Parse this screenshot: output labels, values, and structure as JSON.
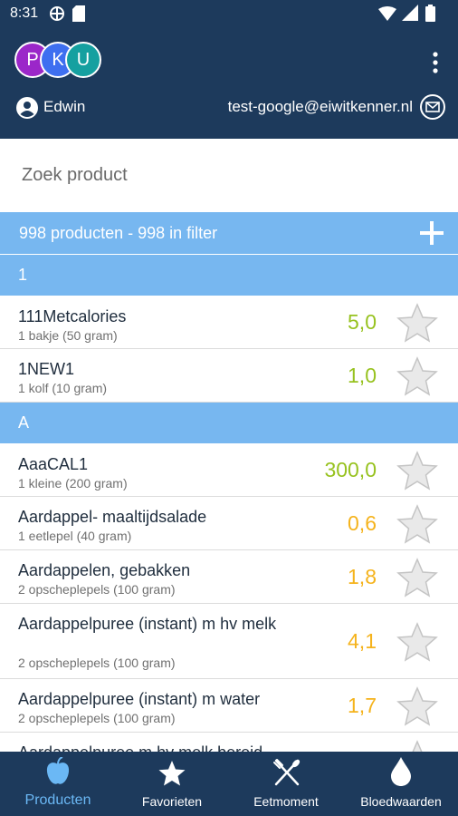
{
  "status": {
    "time": "8:31"
  },
  "app": {
    "logo_letters": [
      "P",
      "K",
      "U"
    ],
    "logo_colors": [
      "#9b27c9",
      "#3e6ff0",
      "#15a0a0"
    ]
  },
  "header": {
    "user_name": "Edwin",
    "email": "test-google@eiwitkenner.nl"
  },
  "search": {
    "placeholder": "Zoek product"
  },
  "filter": {
    "text": "998 producten - 998 in filter"
  },
  "colors": {
    "header_bg": "#1d3a5c",
    "section_bg": "#77b7f0",
    "value_green": "#97c21f",
    "value_orange": "#f5b31c",
    "nav_active": "#6bb8f5"
  },
  "sections": [
    {
      "letter": "1",
      "items": [
        {
          "name": "111Metcalories",
          "portion": "1 bakje (50 gram)",
          "value": "5,0",
          "value_color": "#97c21f"
        },
        {
          "name": "1NEW1",
          "portion": "1 kolf (10 gram)",
          "value": "1,0",
          "value_color": "#97c21f"
        }
      ]
    },
    {
      "letter": "A",
      "items": [
        {
          "name": "AaaCAL1",
          "portion": "1 kleine (200 gram)",
          "value": "300,0",
          "value_color": "#97c21f"
        },
        {
          "name": "Aardappel- maaltijdsalade",
          "portion": "1 eetlepel (40 gram)",
          "value": "0,6",
          "value_color": "#f5b31c"
        },
        {
          "name": "Aardappelen, gebakken",
          "portion": "2 opscheplepels (100 gram)",
          "value": "1,8",
          "value_color": "#f5b31c"
        },
        {
          "name": "Aardappelpuree (instant) m hv melk",
          "portion": "2 opscheplepels (100 gram)",
          "value": "4,1",
          "value_color": "#f5b31c"
        },
        {
          "name": "Aardappelpuree (instant) m water",
          "portion": "2 opscheplepels (100 gram)",
          "value": "1,7",
          "value_color": "#f5b31c"
        },
        {
          "name": "Aardappelpuree m hv melk bereid",
          "portion": "",
          "value": "",
          "value_color": "#f5b31c"
        }
      ]
    }
  ],
  "nav": {
    "producten": "Producten",
    "favorieten": "Favorieten",
    "eetmoment": "Eetmoment",
    "bloedwaarden": "Bloedwaarden"
  }
}
